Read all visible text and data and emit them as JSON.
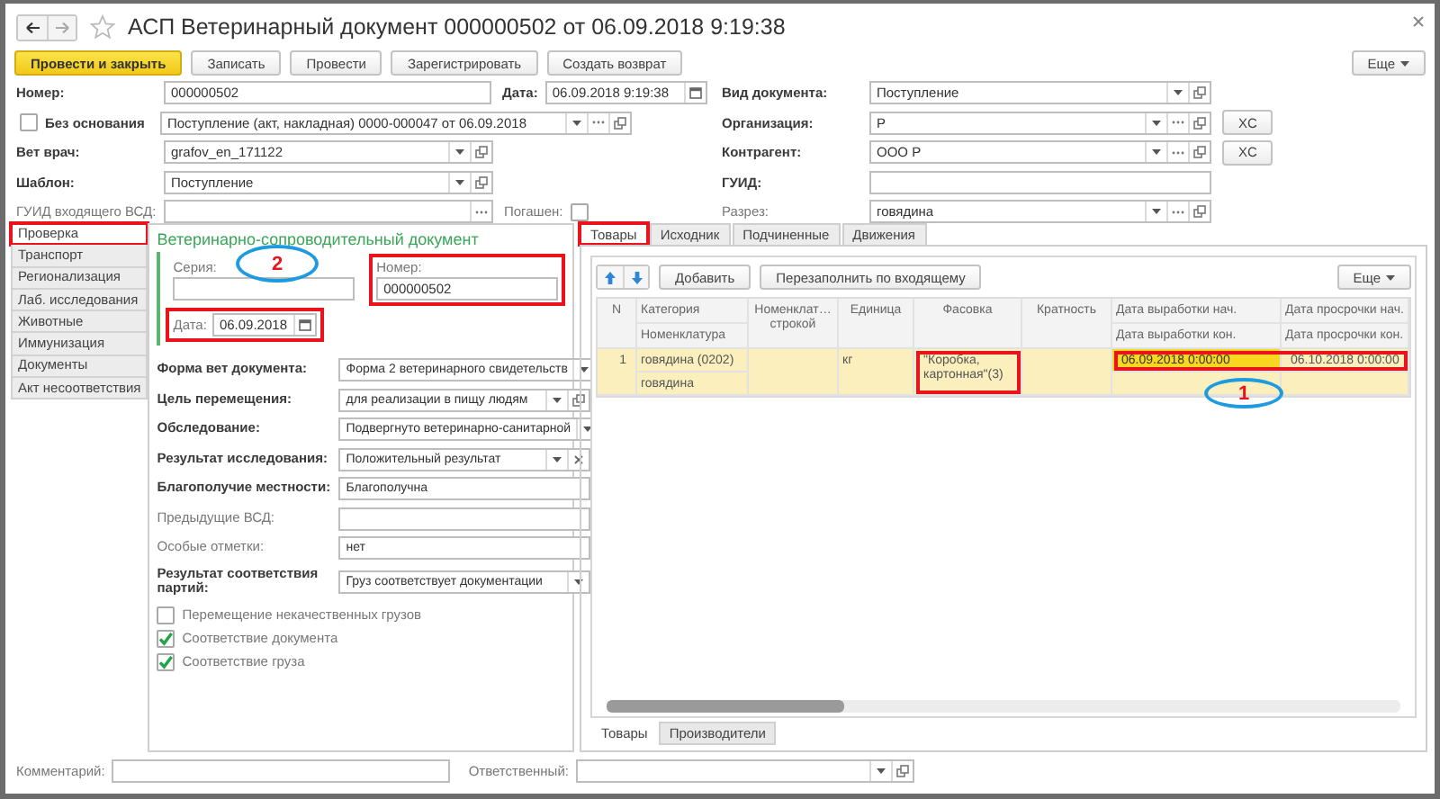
{
  "window": {
    "title": "АСП Ветеринарный документ 000000502 от 06.09.2018 9:19:38"
  },
  "toolbar": {
    "buttons": [
      {
        "label": "Провести и закрыть",
        "kind": "primary"
      },
      {
        "label": "Записать",
        "kind": "normal"
      },
      {
        "label": "Провести",
        "kind": "normal"
      },
      {
        "label": "Зарегистрировать",
        "kind": "normal"
      },
      {
        "label": "Создать возврат",
        "kind": "normal"
      }
    ],
    "more": "Еще"
  },
  "header_left": [
    {
      "kind": "pair",
      "fields": [
        {
          "label": "Номер:",
          "bold": true,
          "value": "000000502"
        },
        {
          "label": "Дата:",
          "bold": true,
          "value": "06.09.2018 9:19:38",
          "buttons": [
            {
              "kind": "calendar"
            }
          ]
        }
      ]
    },
    {
      "kind": "check-field",
      "check": {
        "label": "Без основания",
        "bold": true,
        "checked": false
      },
      "field": {
        "value": "Поступление (акт, накладная) 0000-000047 от 06.09.2018",
        "buttons": [
          {
            "kind": "select"
          },
          {
            "kind": "choose"
          },
          {
            "kind": "open"
          }
        ]
      }
    },
    {
      "kind": "field",
      "field": {
        "label": "Вет врач:",
        "bold": true,
        "value": "grafov_en_171122",
        "buttons": [
          {
            "kind": "select"
          },
          {
            "kind": "open"
          }
        ]
      }
    },
    {
      "kind": "field",
      "field": {
        "label": "Шаблон:",
        "bold": true,
        "value": "Поступление",
        "buttons": [
          {
            "kind": "select"
          },
          {
            "kind": "open"
          }
        ]
      }
    },
    {
      "kind": "field-check",
      "field": {
        "label": "ГУИД входящего ВСД:",
        "bold": false,
        "buttons": [
          {
            "kind": "choose"
          }
        ]
      },
      "check": {
        "label": "Погашен:",
        "bold": false,
        "checked": false
      }
    }
  ],
  "header_right": [
    {
      "label": "Вид документа:",
      "bold": true,
      "value": "Поступление",
      "buttons": [
        {
          "kind": "select"
        },
        {
          "kind": "open"
        }
      ]
    },
    {
      "label": "Организация:",
      "bold": true,
      "value": "Р",
      "buttons": [
        {
          "kind": "select"
        },
        {
          "kind": "choose"
        },
        {
          "kind": "open"
        }
      ],
      "action": "XC"
    },
    {
      "label": "Контрагент:",
      "bold": true,
      "value": "ООО Р",
      "buttons": [
        {
          "kind": "select"
        },
        {
          "kind": "choose"
        },
        {
          "kind": "open"
        }
      ],
      "action": "XC"
    },
    {
      "label": "ГУИД:",
      "bold": true
    },
    {
      "label": "Разрез:",
      "bold": false,
      "value": "говядина",
      "buttons": [
        {
          "kind": "select"
        },
        {
          "kind": "choose"
        },
        {
          "kind": "open"
        }
      ]
    }
  ],
  "left_tabs": [
    {
      "label": "Проверка",
      "selected": true,
      "marked": true
    },
    {
      "label": "Транспорт",
      "selected": false,
      "marked": false
    },
    {
      "label": "Регионализация",
      "selected": false,
      "marked": false
    },
    {
      "label": "Лаб. исследования",
      "selected": false,
      "marked": false
    },
    {
      "label": "Животные",
      "selected": false,
      "marked": false
    },
    {
      "label": "Иммунизация",
      "selected": false,
      "marked": false
    },
    {
      "label": "Документы",
      "selected": false,
      "marked": false
    },
    {
      "label": "Акт несоответствия",
      "selected": false,
      "marked": false
    }
  ],
  "vsd": {
    "title": "Ветеринарно-сопроводительный документ",
    "fields": [
      {
        "kind": "stacked",
        "label": "Серия:",
        "marked": false
      },
      {
        "kind": "stacked",
        "label": "Номер:",
        "value": "000000502",
        "marked": true
      },
      {
        "kind": "inline",
        "label": "Дата:",
        "value": "06.09.2018",
        "buttons": [
          {
            "kind": "calendar"
          }
        ],
        "marked": true
      }
    ]
  },
  "form": [
    {
      "label": "Форма вет документа:",
      "bold": true,
      "value": "Форма 2 ветеринарного свидетельств",
      "buttons": [
        {
          "kind": "select"
        }
      ]
    },
    {
      "label": "Цель перемещения:",
      "bold": true,
      "value": "для реализации в пищу людям",
      "buttons": [
        {
          "kind": "select"
        },
        {
          "kind": "open"
        }
      ]
    },
    {
      "label": "Обследование:",
      "bold": true,
      "value": "Подвергнуто ветеринарно-санитарной",
      "buttons": [
        {
          "kind": "select"
        }
      ]
    },
    {
      "label": "Результат исследования:",
      "bold": true,
      "value": "Положительный результат",
      "buttons": [
        {
          "kind": "select"
        },
        {
          "kind": "clear"
        }
      ]
    },
    {
      "label": "Благополучие местности:",
      "bold": true,
      "value": "Благополучна"
    },
    {
      "label": "Предыдущие ВСД:",
      "bold": false
    },
    {
      "label": "Особые отметки:",
      "bold": false,
      "value": "нет"
    },
    {
      "label": "Результат соответствия партий:",
      "bold": true,
      "value": "Груз соответствует документации",
      "buttons": [
        {
          "kind": "select"
        }
      ]
    }
  ],
  "checks": [
    {
      "label": "Перемещение некачественных грузов",
      "checked": false
    },
    {
      "label": "Соответствие документа",
      "checked": true
    },
    {
      "label": "Соответствие груза",
      "checked": true
    }
  ],
  "tabs": [
    {
      "label": "Товары",
      "selected": true,
      "marked": true
    },
    {
      "label": "Исходник",
      "selected": false,
      "marked": false
    },
    {
      "label": "Подчиненные",
      "selected": false,
      "marked": false
    },
    {
      "label": "Движения",
      "selected": false,
      "marked": false
    }
  ],
  "table": {
    "toolbar": {
      "buttons": [
        {
          "kind": "up"
        },
        {
          "kind": "down"
        },
        {
          "kind": "text",
          "label": "Добавить"
        },
        {
          "kind": "text",
          "label": "Перезаполнить по входящему"
        }
      ],
      "more": "Еще"
    },
    "columns": [
      {
        "text": "N"
      },
      {
        "text": "Категория",
        "sub": "Номенклатура"
      },
      {
        "text": "Номенклат… строкой"
      },
      {
        "text": "Единица"
      },
      {
        "text": "Фасовка"
      },
      {
        "text": "Кратность"
      },
      {
        "text": "Дата выработки нач.",
        "sub": "Дата выработки кон."
      },
      {
        "text": "Дата просрочки нач.",
        "sub": "Дата просрочки кон."
      }
    ],
    "rows": [
      {
        "selected": true,
        "cells": [
          {
            "text": "1",
            "marked": false,
            "active": false
          },
          {
            "text": "говядина (0202)",
            "sub": "говядина",
            "marked": false,
            "active": false
          },
          {
            "marked": false,
            "active": false
          },
          {
            "text": "кг",
            "marked": false,
            "active": false
          },
          {
            "text": "\"Коробка, картонная\"(3)",
            "marked": true,
            "active": false
          },
          {
            "marked": false,
            "active": false
          },
          {
            "text": "06.09.2018 0:00:00",
            "marked": true,
            "active": true
          },
          {
            "text": "06.10.2018 0:00:00",
            "marked": true,
            "active": false
          }
        ]
      }
    ]
  },
  "bottom_tabs": [
    {
      "label": "Товары",
      "selected": true
    },
    {
      "label": "Производители",
      "selected": false
    }
  ],
  "footer": [
    {
      "label": "Комментарий:"
    },
    {
      "label": "Ответственный:",
      "buttons": [
        {
          "kind": "select"
        },
        {
          "kind": "open"
        }
      ]
    }
  ],
  "callouts": [
    {
      "label": "2"
    },
    {
      "label": "1"
    }
  ]
}
